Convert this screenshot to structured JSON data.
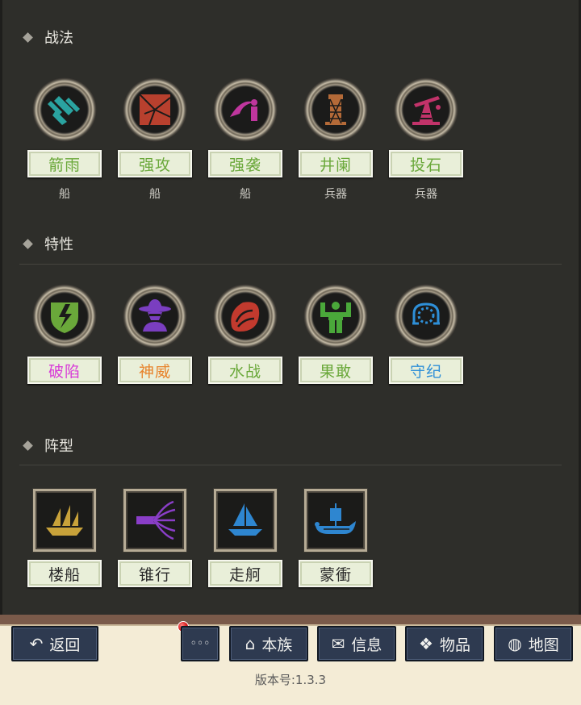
{
  "sections": {
    "tactics": {
      "title": "战法",
      "items": [
        {
          "label": "箭雨",
          "sub": "船",
          "color": "#6aa83a",
          "icon": "arrow-rain-icon"
        },
        {
          "label": "强攻",
          "sub": "船",
          "color": "#6aa83a",
          "icon": "assault-icon"
        },
        {
          "label": "强袭",
          "sub": "船",
          "color": "#6aa83a",
          "icon": "raid-icon"
        },
        {
          "label": "井阑",
          "sub": "兵器",
          "color": "#6aa83a",
          "icon": "siege-tower-icon"
        },
        {
          "label": "投石",
          "sub": "兵器",
          "color": "#6aa83a",
          "icon": "catapult-icon"
        }
      ]
    },
    "traits": {
      "title": "特性",
      "items": [
        {
          "label": "破陷",
          "color": "#d83ad8",
          "icon": "shield-break-icon"
        },
        {
          "label": "神威",
          "color": "#e8822a",
          "icon": "hat-figure-icon"
        },
        {
          "label": "水战",
          "color": "#6aa83a",
          "icon": "water-battle-icon"
        },
        {
          "label": "果敢",
          "color": "#6aa83a",
          "icon": "strongman-icon"
        },
        {
          "label": "守纪",
          "color": "#2e8fd8",
          "icon": "discipline-icon"
        }
      ]
    },
    "formation": {
      "title": "阵型",
      "items": [
        {
          "label": "楼船",
          "color": "#2a2a2a",
          "icon": "tower-ship-icon"
        },
        {
          "label": "锥行",
          "color": "#2a2a2a",
          "icon": "wedge-icon"
        },
        {
          "label": "走舸",
          "color": "#2a2a2a",
          "icon": "sailboat-icon"
        },
        {
          "label": "蒙衝",
          "color": "#2a2a2a",
          "icon": "longship-icon"
        }
      ]
    }
  },
  "toolbar": {
    "back": "返回",
    "more": "◦◦◦",
    "clan": "本族",
    "info": "信息",
    "items": "物品",
    "map": "地图"
  },
  "version": "版本号:1.3.3"
}
